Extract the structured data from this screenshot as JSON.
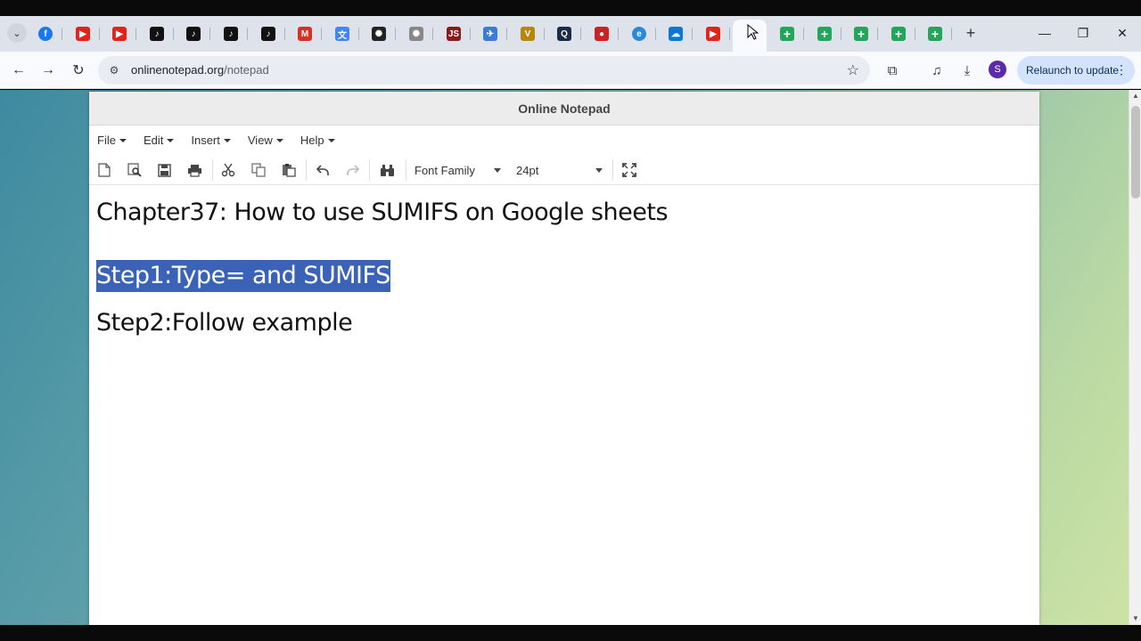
{
  "browser": {
    "tabs": [
      {
        "icon": "facebook-icon",
        "color": "#1877f2",
        "glyph": "f"
      },
      {
        "icon": "youtube-icon",
        "color": "#e62117",
        "glyph": "▶"
      },
      {
        "icon": "youtube-icon",
        "color": "#e62117",
        "glyph": "▶"
      },
      {
        "icon": "tiktok-icon",
        "color": "#111111",
        "glyph": "♪"
      },
      {
        "icon": "tiktok-icon",
        "color": "#111111",
        "glyph": "♪"
      },
      {
        "icon": "tiktok-icon",
        "color": "#111111",
        "glyph": "♪"
      },
      {
        "icon": "tiktok-icon",
        "color": "#111111",
        "glyph": "♪"
      },
      {
        "icon": "gmail-icon",
        "color": "#d93025",
        "glyph": "M"
      },
      {
        "icon": "translate-icon",
        "color": "#4285f4",
        "glyph": "文"
      },
      {
        "icon": "openai-icon",
        "color": "#222222",
        "glyph": "✺"
      },
      {
        "icon": "openai-icon",
        "color": "#888888",
        "glyph": "✺"
      },
      {
        "icon": "javascript-icon",
        "color": "#8b1a1a",
        "glyph": "JS"
      },
      {
        "icon": "africa-icon",
        "color": "#3a7bd5",
        "glyph": "✈"
      },
      {
        "icon": "crest-icon",
        "color": "#b8860b",
        "glyph": "V"
      },
      {
        "icon": "q-icon",
        "color": "#1a2a4a",
        "glyph": "Q"
      },
      {
        "icon": "flag-icon",
        "color": "#cc2222",
        "glyph": "●"
      },
      {
        "icon": "edge-icon",
        "color": "#2a8ad8",
        "glyph": "e"
      },
      {
        "icon": "onedrive-icon",
        "color": "#0a78d4",
        "glyph": "☁"
      },
      {
        "icon": "youtube-icon",
        "color": "#e62117",
        "glyph": "▶"
      },
      {
        "icon": "active-tab-icon",
        "color": "#ffffff",
        "glyph": ""
      },
      {
        "icon": "sheets-icon",
        "color": "#22a65a",
        "glyph": "+"
      },
      {
        "icon": "sheets-icon",
        "color": "#22a65a",
        "glyph": "+"
      },
      {
        "icon": "sheets-icon",
        "color": "#22a65a",
        "glyph": "+"
      },
      {
        "icon": "sheets-icon",
        "color": "#22a65a",
        "glyph": "+"
      },
      {
        "icon": "sheets-icon",
        "color": "#22a65a",
        "glyph": "+"
      }
    ],
    "url_host": "onlinenotepad.org",
    "url_path": "/notepad",
    "avatar_letter": "S",
    "relaunch_label": "Relaunch to update"
  },
  "notepad": {
    "title": "Online Notepad",
    "menus": [
      "File",
      "Edit",
      "Insert",
      "View",
      "Help"
    ],
    "font_family": "Font Family",
    "font_size": "24pt",
    "lines": {
      "line1": "Chapter37: How to use SUMIFS on Google sheets",
      "line2": "Step1:Type= and SUMIFS",
      "line3": "Step2:Follow example"
    }
  }
}
